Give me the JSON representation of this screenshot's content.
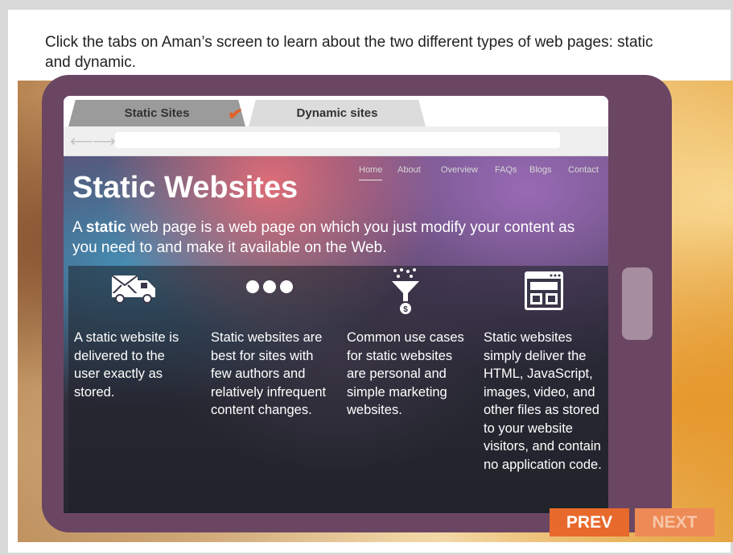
{
  "instruction": "Click the tabs on Aman’s screen to learn about the two different types of web pages: static and dynamic.",
  "tabs": {
    "static": "Static Sites",
    "dynamic": "Dynamic sites"
  },
  "site": {
    "nav": [
      "Home",
      "About",
      "Overview",
      "FAQs",
      "Blogs",
      "Contact"
    ],
    "heading": "Static Websites",
    "intro_prefix": "A ",
    "intro_bold": "static",
    "intro_rest": " web page is a web page on which you just modify your content as you need to and make it available on the Web.",
    "columns": [
      {
        "icon": "delivery-truck-icon",
        "text": "A static website is delivered to the user exactly as stored."
      },
      {
        "icon": "three-dots-icon",
        "text": "Static websites are best for sites with few authors and relatively infrequent content changes."
      },
      {
        "icon": "money-funnel-icon",
        "text": "Common use cases for static websites are personal and simple marketing websites."
      },
      {
        "icon": "webpage-layout-icon",
        "text": "Static websites simply deliver the HTML, JavaScript, images, video, and other files as stored to your website visitors, and contain no application code."
      }
    ]
  },
  "buttons": {
    "prev": "PREV",
    "next": "NEXT"
  },
  "colors": {
    "accent": "#e8692c",
    "tablet": "#6a4663"
  }
}
